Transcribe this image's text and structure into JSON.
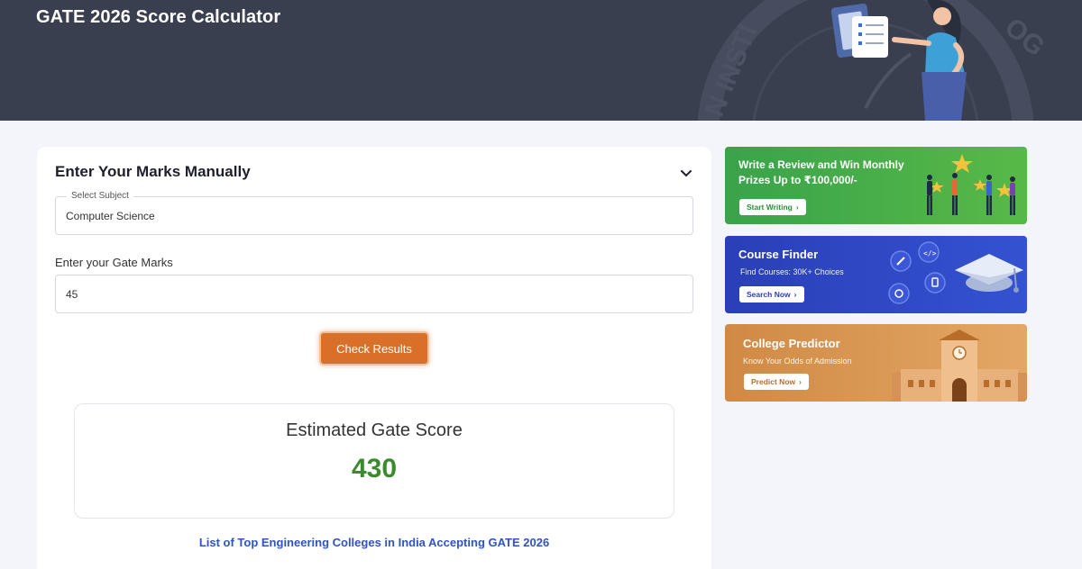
{
  "header": {
    "title": "GATE 2026 Score Calculator"
  },
  "calculator": {
    "title": "Enter Your Marks Manually",
    "subject_label": "Select Subject",
    "subject_value": "Computer Science",
    "marks_label": "Enter your Gate Marks",
    "marks_value": "45",
    "check_button": "Check Results",
    "result_title": "Estimated Gate Score",
    "result_value": "430",
    "colleges_link": "List of Top Engineering Colleges in India Accepting GATE 2026"
  },
  "banners": [
    {
      "title_line1": "Write a Review and Win Monthly",
      "title_line2": "Prizes Up to ₹100,000/-",
      "button": "Start Writing",
      "color": "#4caf48"
    },
    {
      "title": "Course Finder",
      "subtitle": "Find Courses: 30K+ Choices",
      "button": "Search Now",
      "color": "#2f48c4"
    },
    {
      "title": "College Predictor",
      "subtitle": "Know Your Odds of Admission",
      "button": "Predict Now",
      "color": "#d99655"
    }
  ],
  "icons": {
    "collapse": "chevron-down-icon",
    "button_arrow": "chevron-right-icon",
    "hero_illustration": "woman-with-tablet-illustration"
  },
  "colors": {
    "header_bg": "#3a3f4f",
    "button_orange": "#d9702a",
    "score_green": "#3b8a2e",
    "link_blue": "#2f53c6"
  }
}
